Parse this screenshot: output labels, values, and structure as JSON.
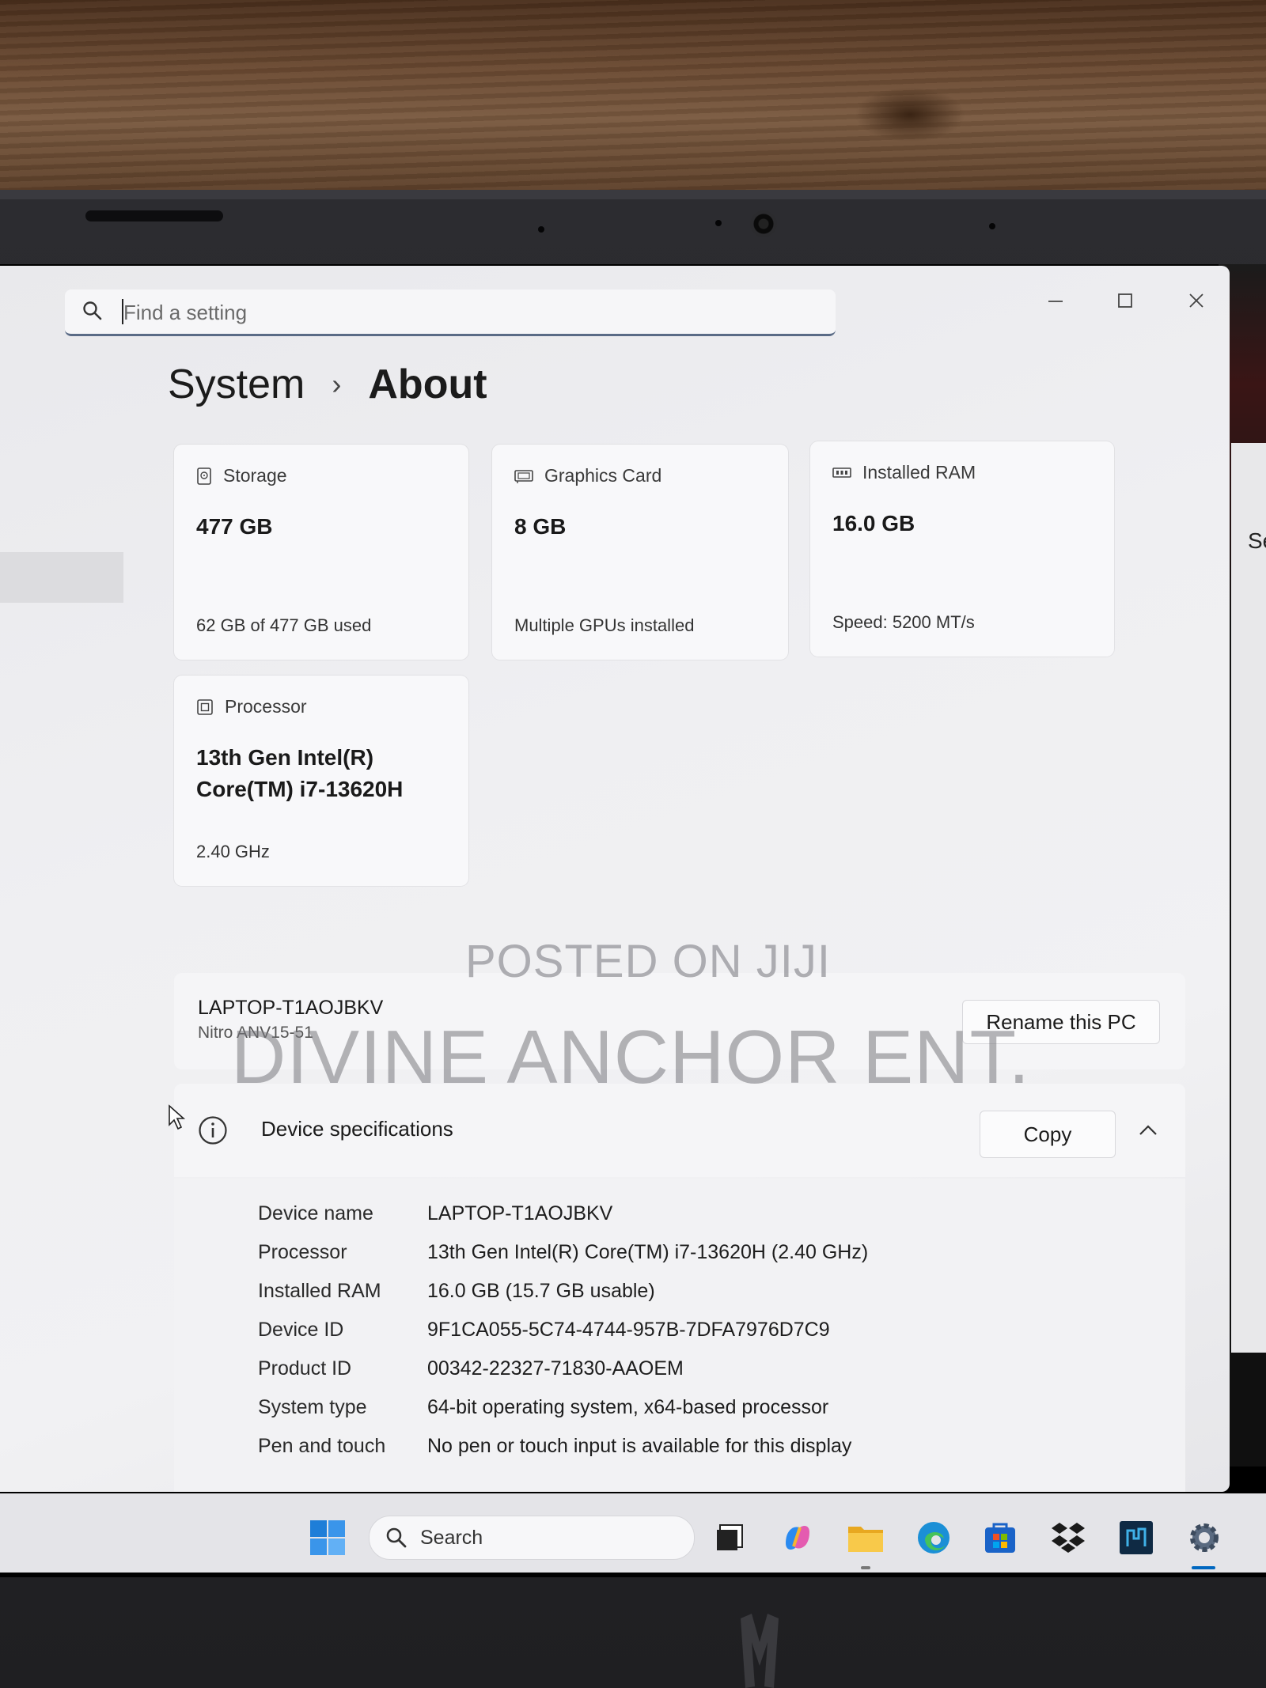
{
  "window": {
    "search_placeholder": "Find a setting",
    "breadcrumb_parent": "System",
    "breadcrumb_current": "About"
  },
  "cards": {
    "storage": {
      "title": "Storage",
      "value": "477 GB",
      "sub": "62 GB of 477 GB used"
    },
    "graphics": {
      "title": "Graphics Card",
      "value": "8 GB",
      "sub": "Multiple GPUs installed"
    },
    "ram": {
      "title": "Installed RAM",
      "value": "16.0 GB",
      "sub": "Speed: 5200 MT/s"
    },
    "processor": {
      "title": "Processor",
      "value_line1": "13th Gen Intel(R)",
      "value_line2": "Core(TM) i7-13620H",
      "sub": "2.40 GHz"
    }
  },
  "pc": {
    "name": "LAPTOP-T1AOJBKV",
    "model": "Nitro ANV15-51",
    "rename_label": "Rename this PC"
  },
  "specs": {
    "title": "Device specifications",
    "copy_label": "Copy",
    "rows": [
      {
        "key": "Device name",
        "value": "LAPTOP-T1AOJBKV"
      },
      {
        "key": "Processor",
        "value": "13th Gen Intel(R) Core(TM) i7-13620H (2.40 GHz)"
      },
      {
        "key": "Installed RAM",
        "value": "16.0 GB (15.7 GB usable)"
      },
      {
        "key": "Device ID",
        "value": "9F1CA055-5C74-4744-957B-7DFA7976D7C9"
      },
      {
        "key": "Product ID",
        "value": "00342-22327-71830-AAOEM"
      },
      {
        "key": "System type",
        "value": "64-bit operating system, x64-based processor"
      },
      {
        "key": "Pen and touch",
        "value": "No pen or touch input is available for this display"
      }
    ]
  },
  "watermark": {
    "line1": "POSTED ON JIJI",
    "line2": "DIVINE ANCHOR ENT."
  },
  "side_window_fragment": "Se",
  "taskbar": {
    "search_label": "Search",
    "icons": [
      "windows-start-icon",
      "task-view-icon",
      "copilot-icon",
      "file-explorer-icon",
      "edge-icon",
      "store-icon",
      "dropbox-icon",
      "app-icon",
      "settings-icon"
    ]
  },
  "colors": {
    "accent": "#0067c0",
    "window_bg": "#efeff2",
    "card_bg": "#f8f8fa",
    "taskbar_bg": "#e4e4e8"
  }
}
